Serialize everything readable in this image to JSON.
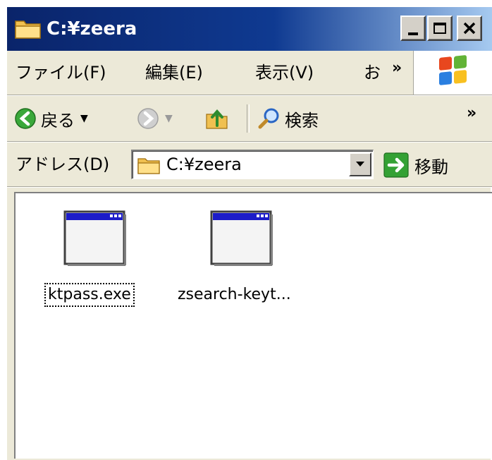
{
  "window": {
    "title": "C:¥zeera",
    "colors": {
      "titlebar_start": "#0a246a",
      "titlebar_end": "#a6caf0",
      "face": "#ece9d8"
    }
  },
  "title_buttons": {
    "minimize_icon": "minimize-icon",
    "maximize_icon": "maximize-icon",
    "close_label": "✕"
  },
  "menubar": {
    "items": [
      "ファイル(F)",
      "編集(E)",
      "表示(V)",
      "お"
    ],
    "overflow": "»"
  },
  "toolbar": {
    "back_label": "戻る",
    "search_label": "検索",
    "overflow": "»"
  },
  "address": {
    "label": "アドレス(D)",
    "value": "C:¥zeera",
    "go_label": "移動"
  },
  "files": [
    {
      "name": "ktpass.exe",
      "focused": true
    },
    {
      "name": "zsearch-keyt...",
      "focused": false
    }
  ]
}
